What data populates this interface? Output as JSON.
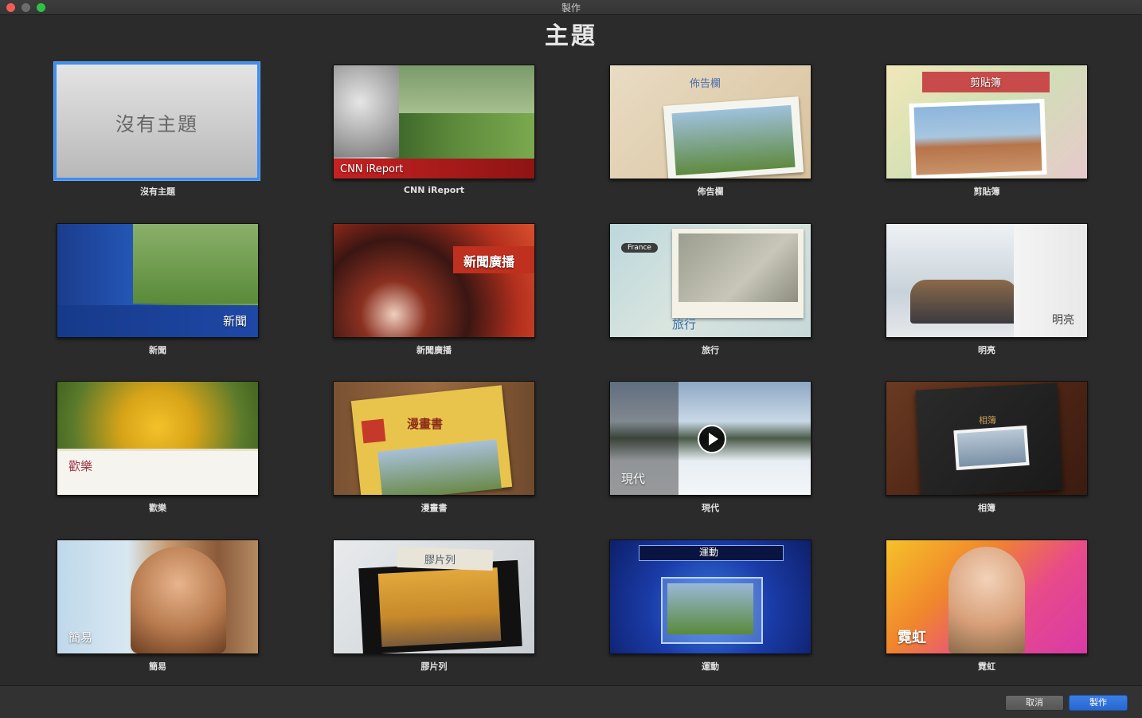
{
  "window": {
    "title": "製作"
  },
  "page_title": "主題",
  "themes": [
    {
      "caption": "沒有主題",
      "overlay": "沒有主題",
      "selected": true
    },
    {
      "caption": "CNN iReport",
      "overlay": "CNN iReport"
    },
    {
      "caption": "佈告欄",
      "overlay": "佈告欄"
    },
    {
      "caption": "剪貼簿",
      "overlay": "剪貼簿"
    },
    {
      "caption": "新聞",
      "overlay": "新聞"
    },
    {
      "caption": "新聞廣播",
      "overlay": "新聞廣播"
    },
    {
      "caption": "旅行",
      "overlay": "旅行",
      "tag": "France"
    },
    {
      "caption": "明亮",
      "overlay": "明亮"
    },
    {
      "caption": "歡樂",
      "overlay": "歡樂"
    },
    {
      "caption": "漫畫書",
      "overlay": "漫畫書"
    },
    {
      "caption": "現代",
      "overlay": "現代"
    },
    {
      "caption": "相簿",
      "overlay": "相簿"
    },
    {
      "caption": "簡易",
      "overlay": "簡易"
    },
    {
      "caption": "膠片列",
      "overlay": "膠片列"
    },
    {
      "caption": "運動",
      "overlay": "運動"
    },
    {
      "caption": "霓虹",
      "overlay": "霓虹"
    }
  ],
  "buttons": {
    "cancel": "取消",
    "create": "製作"
  },
  "colors": {
    "accent": "#3d8ff2",
    "create_button": "#2767cf",
    "background": "#2b2b2b"
  }
}
